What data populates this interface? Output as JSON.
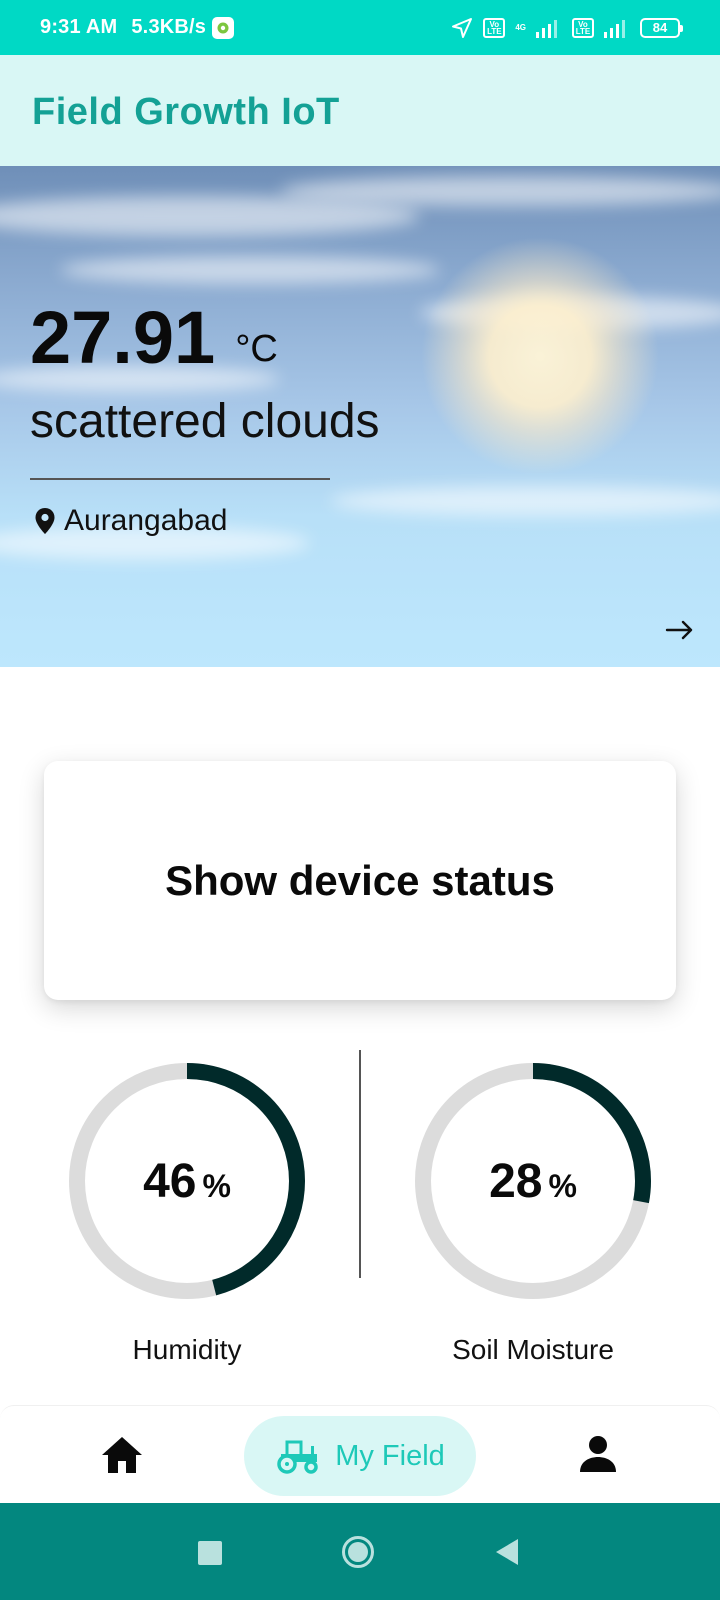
{
  "status_bar": {
    "time": "9:31 AM",
    "net_speed": "5.3KB/s",
    "battery": "84",
    "volte_label": "Vo LTE",
    "network": "4G",
    "icons": [
      "settings-app-icon",
      "location-arrow-icon",
      "volte-icon",
      "signal-icon",
      "battery-icon"
    ]
  },
  "app_bar": {
    "title": "Field Growth IoT"
  },
  "weather": {
    "temperature": "27.91",
    "unit": "°C",
    "condition": "scattered clouds",
    "location": "Aurangabad"
  },
  "device_status": {
    "label": "Show device status"
  },
  "gauges": [
    {
      "value": "46",
      "unit": "%",
      "label": "Humidity",
      "fraction": 0.46
    },
    {
      "value": "28",
      "unit": "%",
      "label": "Soil Moisture",
      "fraction": 0.28
    }
  ],
  "bottom_nav": {
    "items": [
      {
        "label": "Home",
        "icon": "home-icon"
      },
      {
        "label": "My Field",
        "icon": "tractor-icon",
        "active": true
      },
      {
        "label": "Profile",
        "icon": "person-icon"
      }
    ]
  },
  "colors": {
    "status_bar": "#00d9c5",
    "app_bar": "#d9f7f5",
    "title": "#14a195",
    "accent": "#1ec9b8",
    "system_nav": "#03877f",
    "gauge_track": "#dcdcdc",
    "gauge_fill": "#012a2a"
  }
}
